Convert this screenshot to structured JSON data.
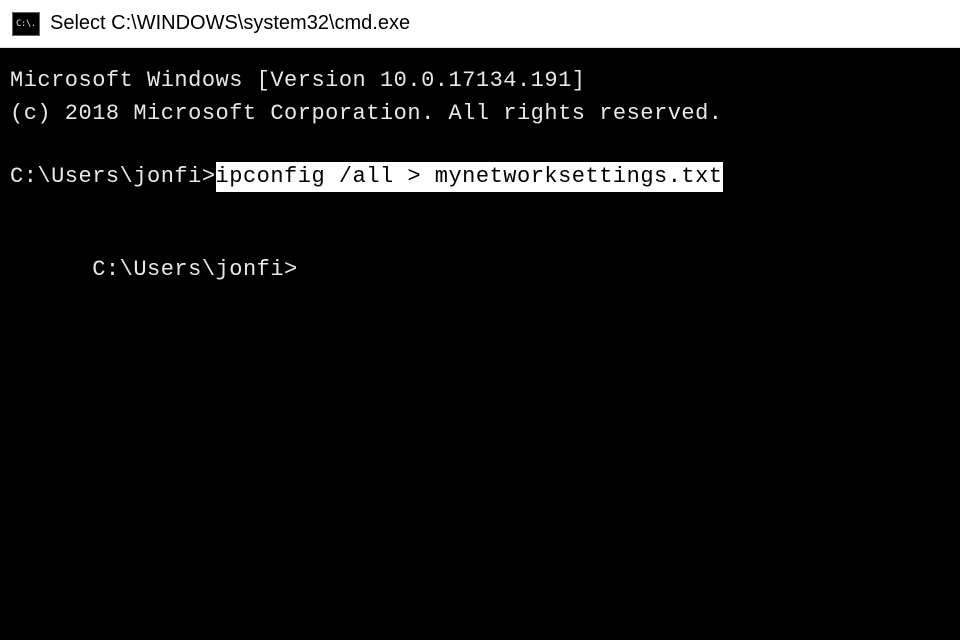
{
  "title_bar": {
    "icon_text": "C:\\.",
    "title": "Select C:\\WINDOWS\\system32\\cmd.exe"
  },
  "terminal": {
    "version_line": "Microsoft Windows [Version 10.0.17134.191]",
    "copyright_line": "(c) 2018 Microsoft Corporation. All rights reserved.",
    "prompt1": "C:\\Users\\jonfi>",
    "command1": "ipconfig /all > mynetworksettings.txt",
    "prompt2": "C:\\Users\\jonfi>"
  }
}
